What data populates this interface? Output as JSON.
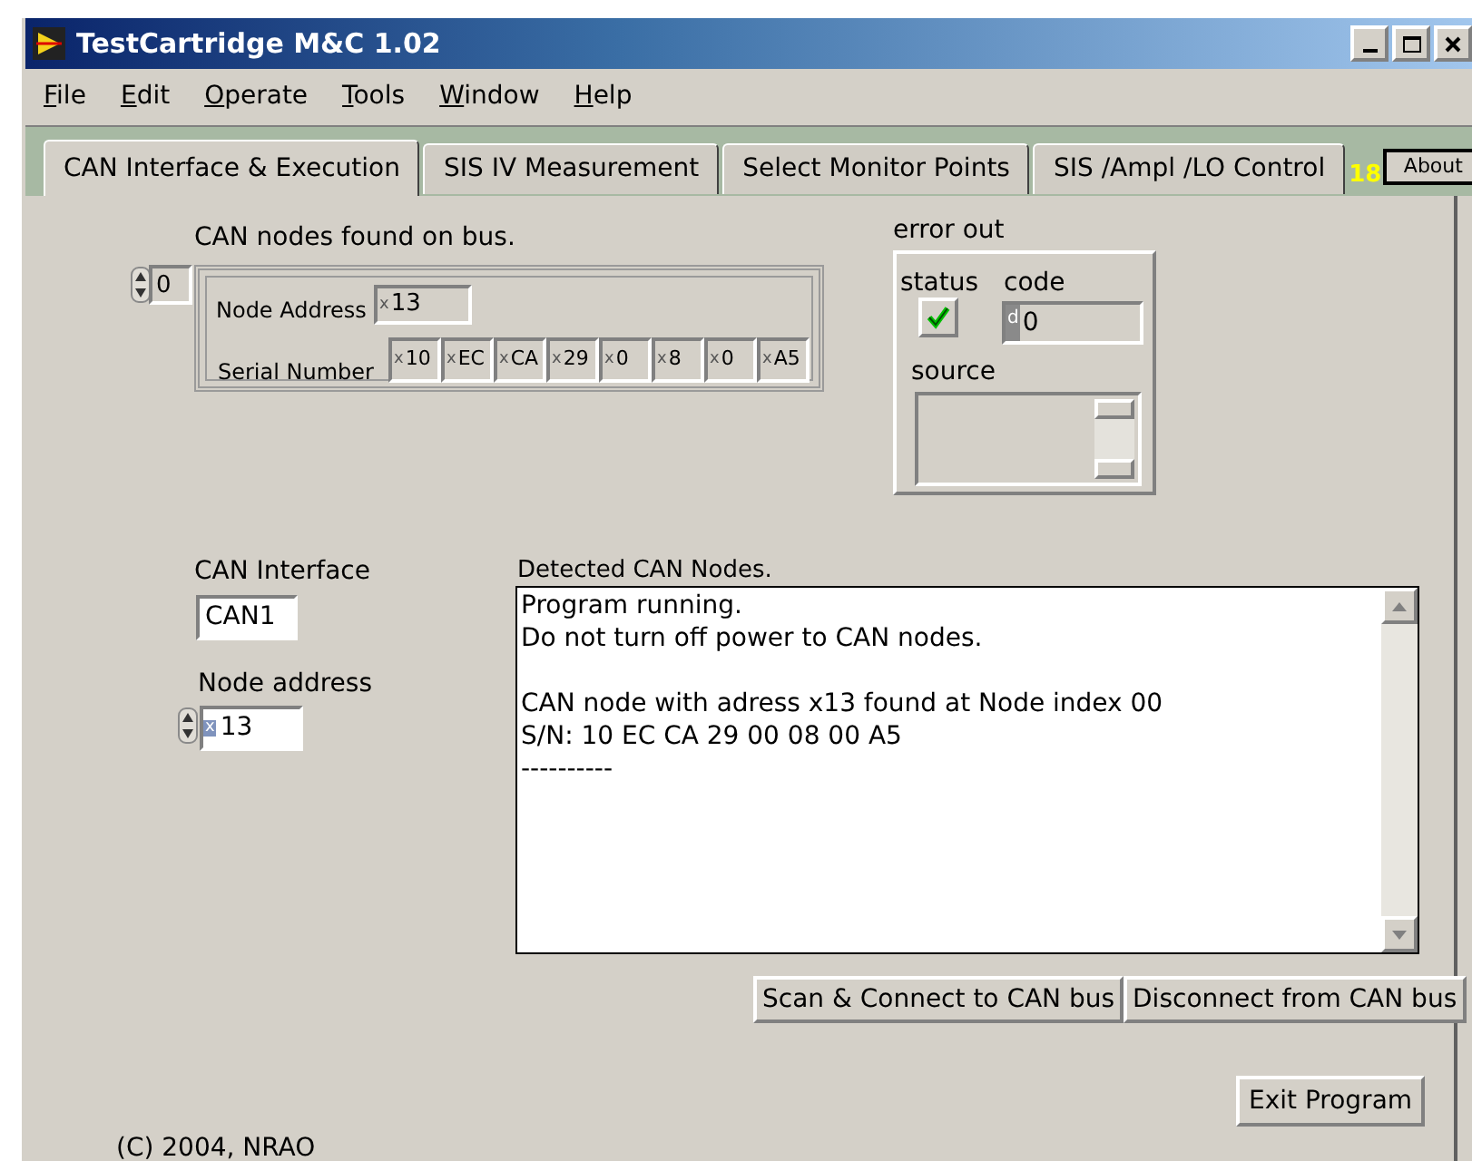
{
  "window": {
    "title": "TestCartridge M&C 1.02"
  },
  "menu": [
    "File",
    "Edit",
    "Operate",
    "Tools",
    "Window",
    "Help"
  ],
  "tabs": [
    {
      "label": "CAN Interface & Execution",
      "selected": true
    },
    {
      "label": "SIS IV Measurement",
      "selected": false
    },
    {
      "label": "Select Monitor Points",
      "selected": false
    },
    {
      "label": "SIS /Ampl /LO Control",
      "selected": false
    }
  ],
  "tab_counter": "18",
  "about_button": "About",
  "nodes_array": {
    "label": "CAN nodes found on bus.",
    "index": "0",
    "node_address_label": "Node Address",
    "node_address": {
      "radix": "x",
      "value": "13"
    },
    "serial_label": "Serial Number",
    "serial": [
      {
        "radix": "x",
        "value": "10"
      },
      {
        "radix": "x",
        "value": "EC"
      },
      {
        "radix": "x",
        "value": "CA"
      },
      {
        "radix": "x",
        "value": "29"
      },
      {
        "radix": "x",
        "value": "0"
      },
      {
        "radix": "x",
        "value": "8"
      },
      {
        "radix": "x",
        "value": "0"
      },
      {
        "radix": "x",
        "value": "A5"
      }
    ]
  },
  "error_out": {
    "label": "error out",
    "status_label": "status",
    "status": true,
    "code_label": "code",
    "code": {
      "radix": "d",
      "value": "0"
    },
    "source_label": "source"
  },
  "can_interface": {
    "label": "CAN Interface",
    "value": "CAN1"
  },
  "node_address": {
    "label": "Node address",
    "radix": "x",
    "value": "13"
  },
  "detected": {
    "label": "Detected CAN Nodes.",
    "paragraphs": [
      [
        "Program running.",
        "Do not turn off power to CAN nodes."
      ],
      [
        "CAN node with adress x13 found at Node index 00",
        "S/N: 10 EC CA 29 00 08 00 A5",
        "----------"
      ]
    ]
  },
  "buttons": [
    "Scan & Connect to CAN bus",
    "Disconnect from CAN bus"
  ],
  "exit_button": "Exit Program",
  "copyright": "(C) 2004, NRAO"
}
